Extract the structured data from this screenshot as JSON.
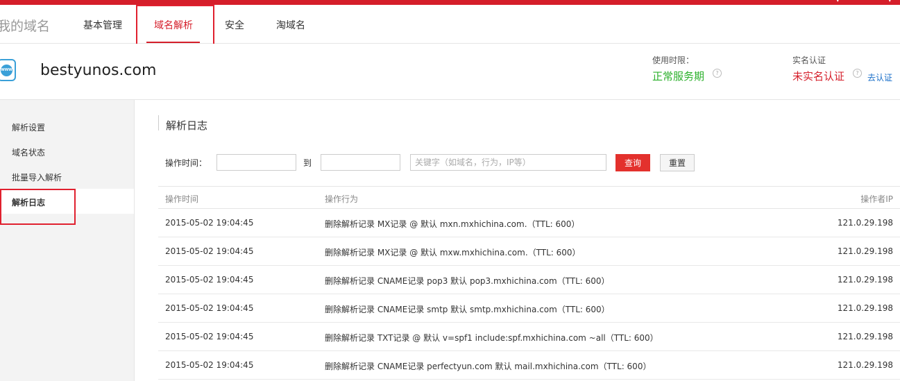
{
  "nav": {
    "title": "我的域名",
    "items": [
      {
        "label": "基本管理"
      },
      {
        "label": "域名解析"
      },
      {
        "label": "安全"
      },
      {
        "label": "淘域名"
      }
    ]
  },
  "domain": {
    "icon": "www-globe-icon",
    "name": "bestyunos.com",
    "usage_label": "使用时限：",
    "usage_value": "正常服务期",
    "verify_label": "实名认证",
    "verify_value": "未实名认证",
    "verify_link": "去认证"
  },
  "sidebar": {
    "items": [
      {
        "label": "解析设置"
      },
      {
        "label": "域名状态"
      },
      {
        "label": "批量导入解析"
      },
      {
        "label": "解析日志"
      }
    ]
  },
  "main": {
    "title": "解析日志",
    "filter": {
      "time_label": "操作时间：",
      "start_value": "",
      "to_label": "到",
      "end_value": "",
      "keyword_placeholder": "关键字（如域名，行为，IP等）",
      "query_label": "查询",
      "reset_label": "重置"
    },
    "table": {
      "headers": [
        "操作时间",
        "操作行为",
        "操作者IP"
      ],
      "rows": [
        {
          "time": "2015-05-02 19:04:45",
          "action": "删除解析记录 MX记录 @ 默认 mxn.mxhichina.com.（TTL: 600）",
          "ip": "121.0.29.198"
        },
        {
          "time": "2015-05-02 19:04:45",
          "action": "删除解析记录 MX记录 @ 默认 mxw.mxhichina.com.（TTL: 600）",
          "ip": "121.0.29.198"
        },
        {
          "time": "2015-05-02 19:04:45",
          "action": "删除解析记录 CNAME记录 pop3 默认 pop3.mxhichina.com（TTL: 600）",
          "ip": "121.0.29.198"
        },
        {
          "time": "2015-05-02 19:04:45",
          "action": "删除解析记录 CNAME记录 smtp 默认 smtp.mxhichina.com（TTL: 600）",
          "ip": "121.0.29.198"
        },
        {
          "time": "2015-05-02 19:04:45",
          "action": "删除解析记录 TXT记录 @ 默认 v=spf1 include:spf.mxhichina.com ~all（TTL: 600）",
          "ip": "121.0.29.198"
        },
        {
          "time": "2015-05-02 19:04:45",
          "action": "删除解析记录 CNAME记录 perfectyun.com 默认 mail.mxhichina.com（TTL: 600）",
          "ip": "121.0.29.198"
        }
      ]
    }
  },
  "colors": {
    "brand_red": "#d51e2a",
    "status_green": "#2bb02b",
    "link_blue": "#1a6fc9",
    "highlight_box": "#e0202e"
  }
}
